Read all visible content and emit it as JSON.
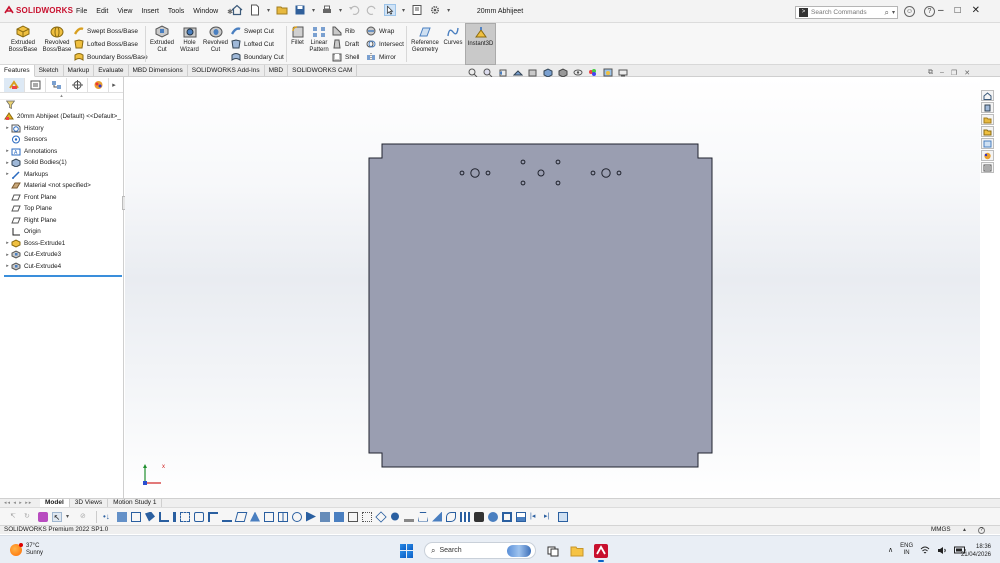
{
  "app": {
    "brand": "SOLIDWORKS",
    "document_title": "20mm Abhijeet",
    "menus": [
      "File",
      "Edit",
      "View",
      "Insert",
      "Tools",
      "Window"
    ],
    "search_placeholder": "Search Commands",
    "accent_color": "#c8102e"
  },
  "ribbon": {
    "extruded_boss": "Extruded Boss/Base",
    "revolved_boss": "Revolved Boss/Base",
    "swept_boss": "Swept Boss/Base",
    "lofted_boss": "Lofted Boss/Base",
    "boundary_boss": "Boundary Boss/Base",
    "extruded_cut": "Extruded Cut",
    "hole_wizard": "Hole Wizard",
    "revolved_cut": "Revolved Cut",
    "swept_cut": "Swept Cut",
    "lofted_cut": "Lofted Cut",
    "boundary_cut": "Boundary Cut",
    "fillet": "Fillet",
    "linear_pattern": "Linear Pattern",
    "rib": "Rib",
    "draft": "Draft",
    "shell": "Shell",
    "wrap": "Wrap",
    "intersect": "Intersect",
    "mirror": "Mirror",
    "reference_geometry": "Reference Geometry",
    "curves": "Curves",
    "instant3d": "Instant3D"
  },
  "tabs": [
    "Features",
    "Sketch",
    "Markup",
    "Evaluate",
    "MBD Dimensions",
    "SOLIDWORKS Add-Ins",
    "MBD",
    "SOLIDWORKS CAM"
  ],
  "active_tab": "Features",
  "tree": {
    "root": "20mm Abhijeet (Default) <<Default>_",
    "items": [
      {
        "label": "History",
        "expandable": true,
        "icon": "history-icon"
      },
      {
        "label": "Sensors",
        "expandable": false,
        "icon": "sensor-icon"
      },
      {
        "label": "Annotations",
        "expandable": true,
        "icon": "annotation-icon"
      },
      {
        "label": "Solid Bodies(1)",
        "expandable": true,
        "icon": "solid-bodies-icon"
      },
      {
        "label": "Markups",
        "expandable": true,
        "icon": "markup-icon"
      },
      {
        "label": "Material <not specified>",
        "expandable": false,
        "icon": "material-icon"
      },
      {
        "label": "Front Plane",
        "expandable": false,
        "icon": "plane-icon"
      },
      {
        "label": "Top Plane",
        "expandable": false,
        "icon": "plane-icon"
      },
      {
        "label": "Right Plane",
        "expandable": false,
        "icon": "plane-icon"
      },
      {
        "label": "Origin",
        "expandable": false,
        "icon": "origin-icon"
      },
      {
        "label": "Boss-Extrude1",
        "expandable": true,
        "icon": "boss-extrude-icon"
      },
      {
        "label": "Cut-Extrude3",
        "expandable": true,
        "icon": "cut-extrude-icon"
      },
      {
        "label": "Cut-Extrude4",
        "expandable": true,
        "icon": "cut-extrude-icon"
      }
    ]
  },
  "triad": {
    "x_label": "x"
  },
  "part_color": "#9a9eb1",
  "bottom_tabs": [
    "Model",
    "3D Views",
    "Motion Study 1"
  ],
  "active_bottom_tab": "Model",
  "status": {
    "left": "SOLIDWORKS Premium 2022 SP1.0",
    "units": "MMGS",
    "help": "?"
  },
  "taskbar": {
    "weather_temp": "37°C",
    "weather_desc": "Sunny",
    "search": "Search",
    "lang_1": "ENG",
    "lang_2": "IN",
    "time": "18:36",
    "date": "21/04/2026"
  }
}
